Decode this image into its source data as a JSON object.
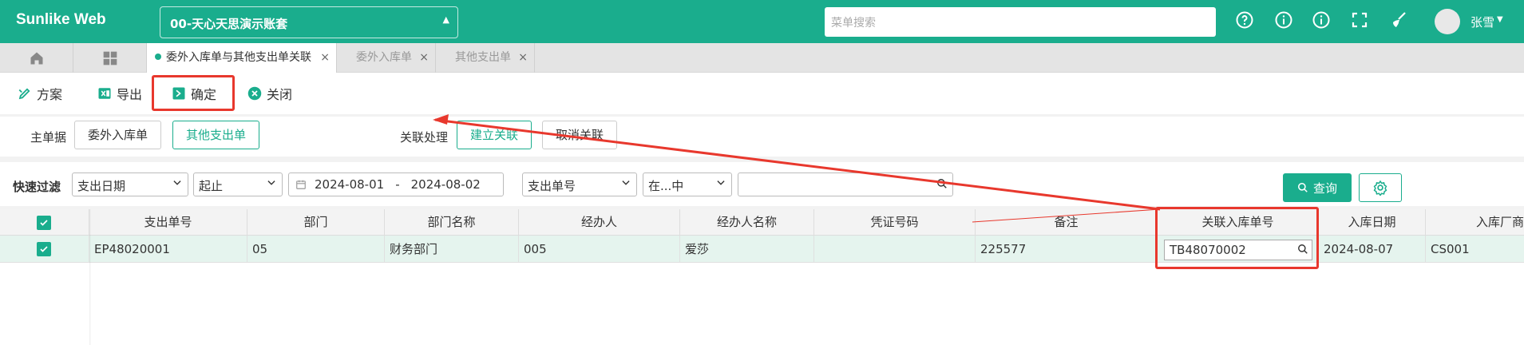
{
  "header": {
    "logo": "Sunlike Web",
    "account": "00-天心天思演示账套",
    "search_placeholder": "菜单搜索",
    "user": "张雪"
  },
  "tabs": [
    {
      "label": "委外入库单与其他支出单关联",
      "active": true
    },
    {
      "label": "委外入库单",
      "active": false
    },
    {
      "label": "其他支出单",
      "active": false
    }
  ],
  "toolbar": {
    "scheme": "方案",
    "export": "导出",
    "confirm": "确定",
    "close": "关闭"
  },
  "relation": {
    "main_label": "主单据",
    "btn_outsource": "委外入库单",
    "btn_other": "其他支出单",
    "process_label": "关联处理",
    "btn_create": "建立关联",
    "btn_cancel": "取消关联"
  },
  "filter": {
    "label": "快速过滤",
    "field1": "支出日期",
    "op1": "起止",
    "date_from": "2024-08-01",
    "date_sep": "-",
    "date_to": "2024-08-02",
    "field2": "支出单号",
    "op2": "在...中",
    "value2": "",
    "query": "查询"
  },
  "grid": {
    "columns": [
      "支出单号",
      "部门",
      "部门名称",
      "经办人",
      "经办人名称",
      "凭证号码",
      "备注",
      "关联入库单号",
      "入库日期",
      "入库厂商"
    ],
    "rows": [
      {
        "no": "EP48020001",
        "dept": "05",
        "dept_name": "财务部门",
        "handler": "005",
        "handler_name": "爱莎",
        "voucher": "",
        "remark": "225577",
        "link_no": "TB48070002",
        "in_date": "2024-08-07",
        "vendor": "CS001"
      }
    ]
  },
  "colors": {
    "brand": "#1aad8d",
    "highlight": "#e8382d"
  }
}
